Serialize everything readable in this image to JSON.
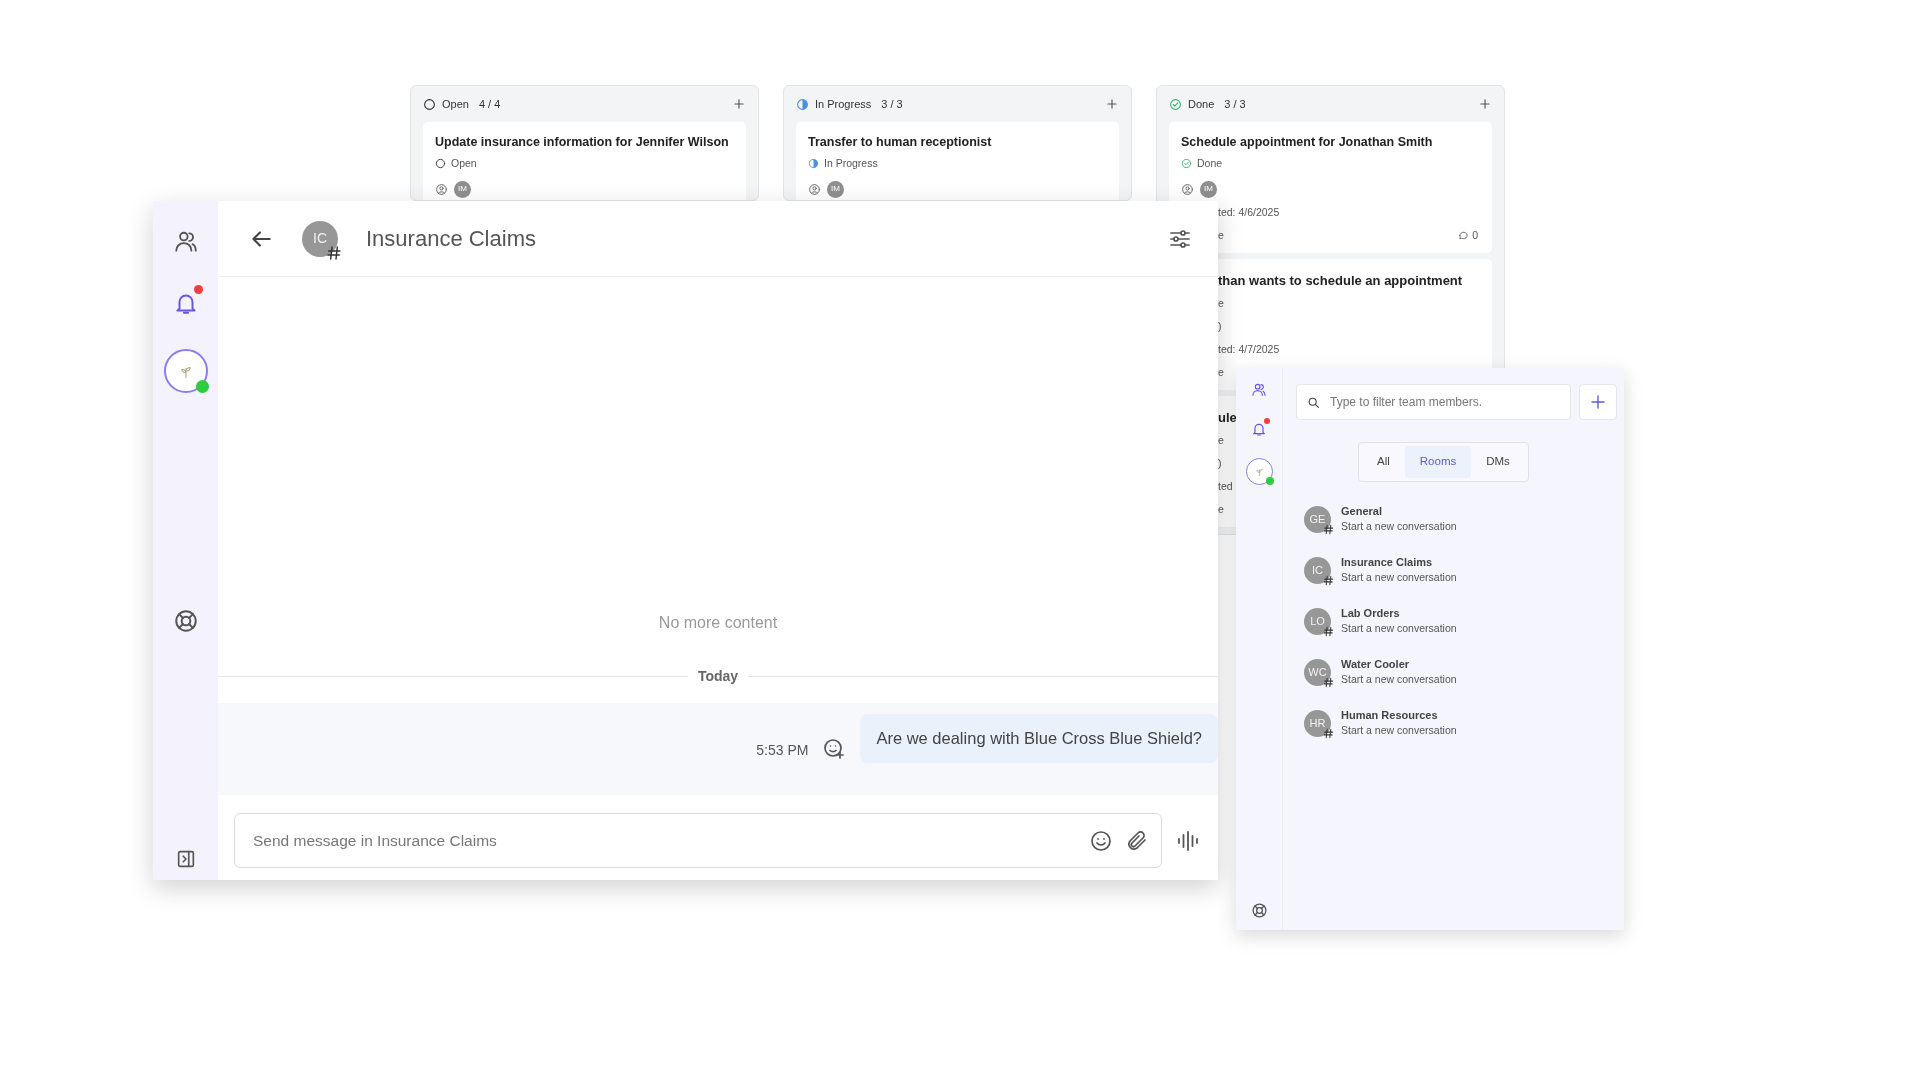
{
  "board": {
    "columns": [
      {
        "kind": "open",
        "title": "Open",
        "count": "4 / 4",
        "cards": [
          {
            "title": "Update insurance information for Jennifer Wilson",
            "status": "Open",
            "assignee": "IM"
          }
        ]
      },
      {
        "kind": "progress",
        "title": "In Progress",
        "count": "3 / 3",
        "cards": [
          {
            "title": "Transfer to human receptionist",
            "status": "In Progress",
            "assignee": "IM"
          }
        ]
      },
      {
        "kind": "done",
        "title": "Done",
        "count": "3 / 3",
        "cards": [
          {
            "title": "Schedule appointment for Jonathan Smith",
            "status": "Done",
            "assignee": "IM",
            "fragments": [
              {
                "kind": "meta",
                "text": "ted: 4/6/2025"
              },
              {
                "kind": "meta",
                "text": "e",
                "comments": "0"
              }
            ]
          },
          {
            "fragments": [
              {
                "kind": "title",
                "text": "than wants to schedule an appointment"
              },
              {
                "kind": "meta",
                "text": "e"
              },
              {
                "kind": "meta",
                "text": ")"
              },
              {
                "kind": "meta",
                "text": "ted: 4/7/2025"
              },
              {
                "kind": "meta",
                "text": "e"
              }
            ]
          },
          {
            "fragments": [
              {
                "kind": "title",
                "text": "ule"
              },
              {
                "kind": "meta",
                "text": "e"
              },
              {
                "kind": "meta",
                "text": ")"
              },
              {
                "kind": "meta",
                "text": "ted"
              },
              {
                "kind": "meta",
                "text": "e"
              }
            ]
          }
        ]
      }
    ]
  },
  "chat": {
    "rail": {
      "unread": true,
      "online": true
    },
    "header": {
      "initials": "IC",
      "title": "Insurance Claims"
    },
    "end_note": "No more content",
    "divider": "Today",
    "messages": [
      {
        "time": "5:53 PM",
        "text": "Are we dealing with Blue Cross Blue Shield?"
      }
    ],
    "composer": {
      "placeholder": "Send message in Insurance Claims"
    }
  },
  "panel": {
    "rail": {
      "unread": true,
      "online": true
    },
    "search": {
      "placeholder": "Type to filter team members."
    },
    "tabs": [
      {
        "label": "All",
        "selected": false
      },
      {
        "label": "Rooms",
        "selected": true
      },
      {
        "label": "DMs",
        "selected": false
      }
    ],
    "rooms": [
      {
        "initials": "GE",
        "name": "General",
        "subtitle": "Start a new conversation"
      },
      {
        "initials": "IC",
        "name": "Insurance Claims",
        "subtitle": "Start a new conversation"
      },
      {
        "initials": "LO",
        "name": "Lab Orders",
        "subtitle": "Start a new conversation"
      },
      {
        "initials": "WC",
        "name": "Water Cooler",
        "subtitle": "Start a new conversation"
      },
      {
        "initials": "HR",
        "name": "Human Resources",
        "subtitle": "Start a new conversation"
      }
    ]
  }
}
